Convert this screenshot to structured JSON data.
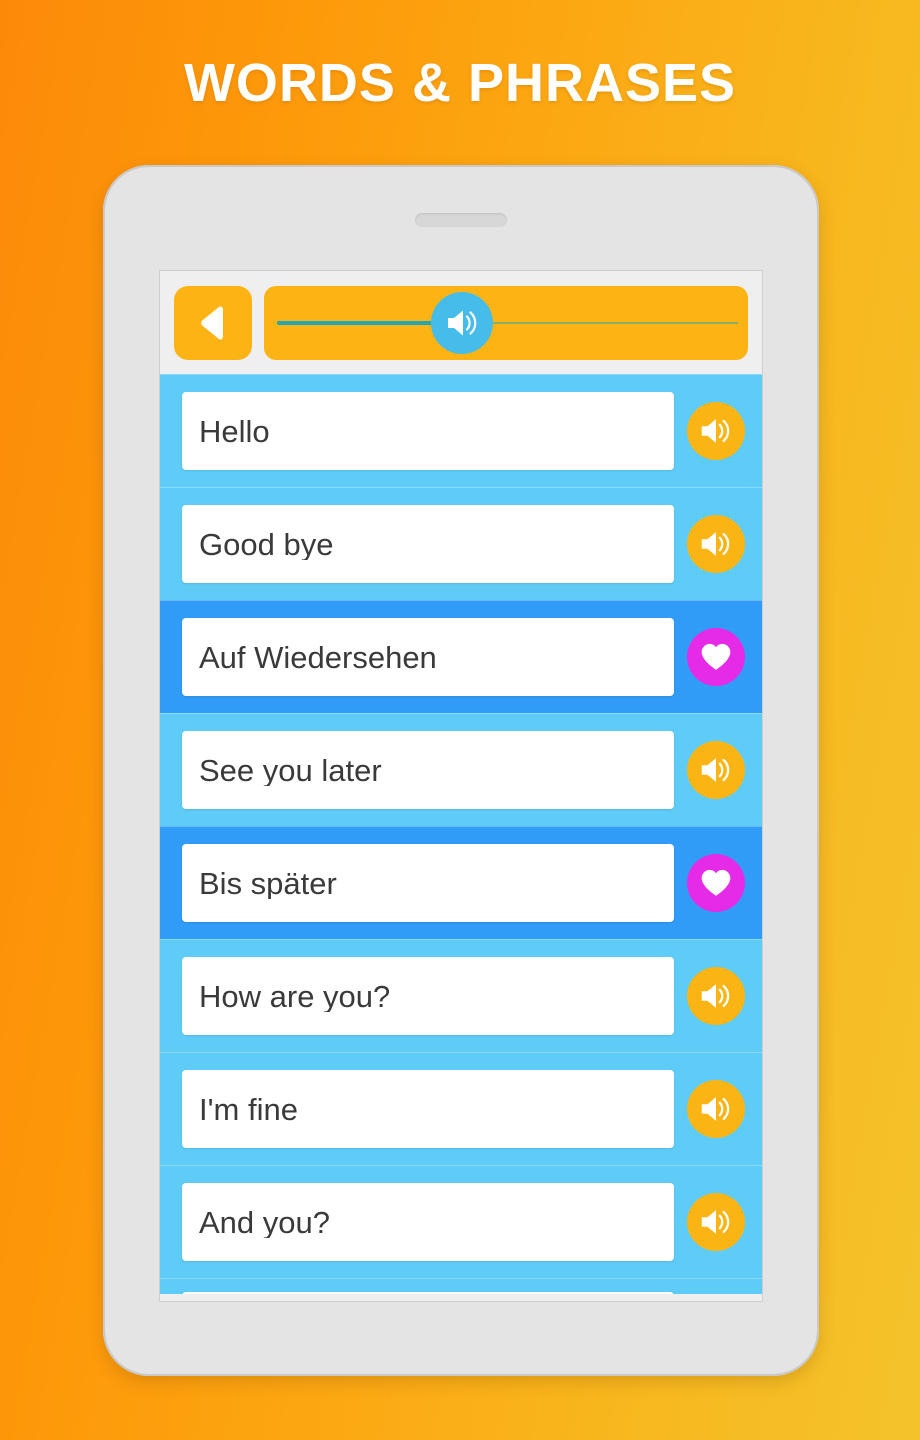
{
  "page": {
    "title": "WORDS & PHRASES",
    "background_gradient_start": "#FC8A09",
    "background_gradient_end": "#F4C32B"
  },
  "device": {
    "frame_color": "#E4E4E4",
    "earpiece_label": "earpiece-speaker"
  },
  "app": {
    "toolbar": {
      "back_button_label": "Back",
      "back_icon": "back-triangle-icon",
      "volume_slider": {
        "label": "Volume",
        "icon": "speaker-icon",
        "value_percent": 41,
        "min": 0,
        "max": 100,
        "thumb_color": "#46BCEA",
        "track_fill_color": "#22A6B3",
        "bar_color": "#FCB415"
      }
    },
    "colors": {
      "row_light": "#5FCCF8",
      "row_dark": "#319CF8",
      "speaker_button": "#FAB514",
      "favorite_button": "#E52BE8",
      "text": "#3A3A3A"
    },
    "list": {
      "rows": [
        {
          "text": "Hello",
          "style": "light",
          "action": "speaker",
          "action_icon": "speaker-icon",
          "partial": false
        },
        {
          "text": "Good bye",
          "style": "light",
          "action": "speaker",
          "action_icon": "speaker-icon",
          "partial": false
        },
        {
          "text": "Auf Wiedersehen",
          "style": "dark",
          "action": "heart",
          "action_icon": "heart-icon",
          "partial": false
        },
        {
          "text": "See you later",
          "style": "light",
          "action": "speaker",
          "action_icon": "speaker-icon",
          "partial": false
        },
        {
          "text": "Bis später",
          "style": "dark",
          "action": "heart",
          "action_icon": "heart-icon",
          "partial": false
        },
        {
          "text": "How are you?",
          "style": "light",
          "action": "speaker",
          "action_icon": "speaker-icon",
          "partial": false
        },
        {
          "text": "I'm fine",
          "style": "light",
          "action": "speaker",
          "action_icon": "speaker-icon",
          "partial": false
        },
        {
          "text": "And you?",
          "style": "light",
          "action": "speaker",
          "action_icon": "speaker-icon",
          "partial": false
        },
        {
          "text": "",
          "style": "light",
          "action": "none",
          "action_icon": "",
          "partial": true
        }
      ]
    }
  }
}
